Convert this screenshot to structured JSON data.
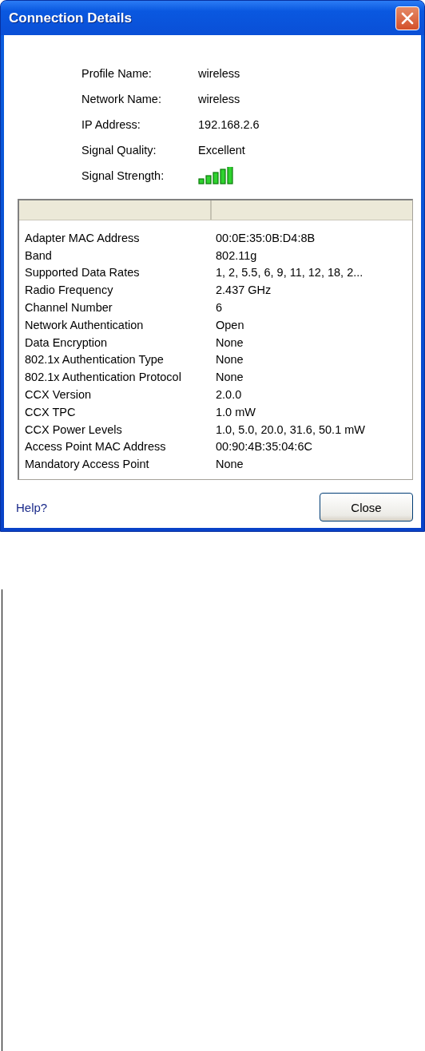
{
  "window": {
    "title": "Connection Details"
  },
  "summary": [
    {
      "label": "Profile Name:",
      "value": "wireless",
      "kind": "text"
    },
    {
      "label": "Network Name:",
      "value": "wireless",
      "kind": "text"
    },
    {
      "label": "IP Address:",
      "value": "192.168.2.6",
      "kind": "text"
    },
    {
      "label": "Signal Quality:",
      "value": "Excellent",
      "kind": "text"
    },
    {
      "label": "Signal Strength:",
      "kind": "signal"
    }
  ],
  "table": {
    "rows": [
      [
        "Adapter MAC Address",
        "00:0E:35:0B:D4:8B"
      ],
      [
        "Band",
        "802.11g"
      ],
      [
        "Supported Data Rates",
        "1, 2, 5.5, 6, 9, 11, 12, 18, 2..."
      ],
      [
        "Radio Frequency",
        "2.437 GHz"
      ],
      [
        "Channel Number",
        "6"
      ],
      [
        "Network Authentication",
        "Open"
      ],
      [
        "Data Encryption",
        "None"
      ],
      [
        "802.1x Authentication Type",
        "None"
      ],
      [
        "802.1x Authentication Protocol",
        "None"
      ],
      [
        "CCX Version",
        "2.0.0"
      ],
      [
        "CCX TPC",
        "1.0 mW"
      ],
      [
        "CCX Power Levels",
        "1.0, 5.0, 20.0, 31.6, 50.1 mW"
      ],
      [
        "Access Point MAC Address",
        "00:90:4B:35:04:6C"
      ],
      [
        "Mandatory Access Point",
        "None"
      ]
    ]
  },
  "help_link": "Help?",
  "buttons": [
    "Close"
  ]
}
